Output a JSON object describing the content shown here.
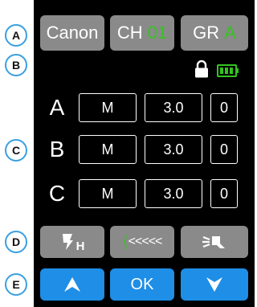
{
  "callouts": [
    "A",
    "B",
    "C",
    "D",
    "E"
  ],
  "top_bar": {
    "brand": "Canon",
    "channel_label": "CH",
    "channel_value": "01",
    "group_label": "GR",
    "group_value": "A"
  },
  "status": {
    "lock_icon": "lock-icon",
    "battery_icon": "battery-full-icon"
  },
  "groups": [
    {
      "label": "A",
      "mode": "M",
      "power": "3.0",
      "comp": "0"
    },
    {
      "label": "B",
      "mode": "M",
      "power": "3.0",
      "comp": "0"
    },
    {
      "label": "C",
      "mode": "M",
      "power": "3.0",
      "comp": "0"
    }
  ],
  "function_buttons": {
    "hss_icon": "high-speed-sync-icon",
    "hss_subscript": "H",
    "arrows": "<<<<<",
    "modeling_icon": "modeling-light-icon"
  },
  "nav": {
    "up_icon": "chevron-up-icon",
    "ok_label": "OK",
    "down_icon": "chevron-down-icon"
  },
  "colors": {
    "accent_blue": "#1e8ee6",
    "green": "#34c41f",
    "button_gray": "#8a8a8a"
  }
}
